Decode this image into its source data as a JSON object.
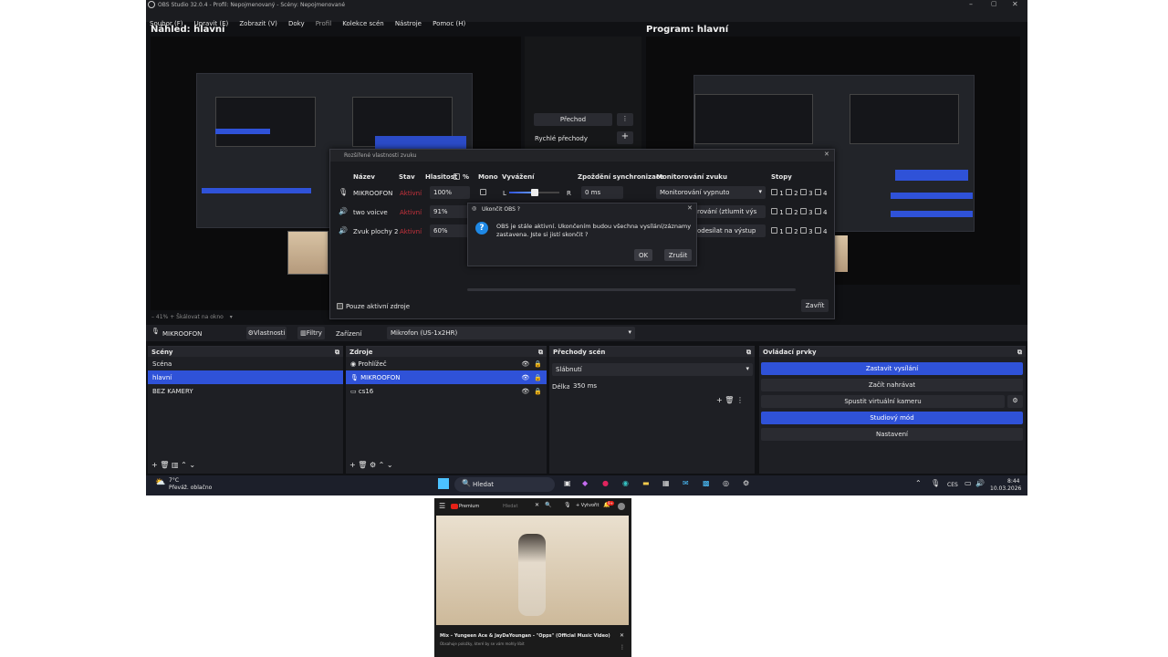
{
  "window": {
    "title": "OBS Studio 32.0.4 - Profil: Nepojmenovaný - Scény: Nepojmenované",
    "menu": [
      "Soubor (F)",
      "Upravit (E)",
      "Zobrazit (V)",
      "Doky",
      "Profil",
      "Kolekce scén",
      "Nástroje",
      "Pomoc (H)"
    ]
  },
  "preview": {
    "title": "Náhled: hlavní"
  },
  "program": {
    "title": "Program: hlavní"
  },
  "transition": {
    "button": "Přechod",
    "quick": "Rychlé přechody"
  },
  "advanced_audio": {
    "title": "Rozšířené vlastnosti zvuku",
    "headers": [
      "Název",
      "Stav",
      "Hlasitost",
      "%",
      "Mono",
      "Vyvážení",
      "Zpoždění synchronizace",
      "Monitorování zvuku",
      "Stopy"
    ],
    "rows": [
      {
        "name": "MIKROOFON",
        "status": "Aktivní",
        "volume": "100%",
        "sync": "0 ms",
        "monitor": "Monitorování vypnuto"
      },
      {
        "name": "two voicve",
        "status": "Aktivní",
        "volume": "91%",
        "monitor": "rování (ztlumit výs"
      },
      {
        "name": "Zvuk plochy 2",
        "status": "Aktivní",
        "volume": "60%",
        "monitor": "odesílat na výstup"
      }
    ],
    "balance_l": "L",
    "balance_r": "R",
    "tracks": [
      "1",
      "2",
      "3",
      "4"
    ],
    "only_active": "Pouze aktivní zdroje",
    "close": "Zavřít"
  },
  "quit_dialog": {
    "title": "Ukončit OBS ?",
    "message1": "OBS je stále aktivní. Ukončením budou všechna vysílání/záznamy",
    "message2": "zastavena. Jste si jistí skončit ?",
    "ok": "OK",
    "cancel": "Zrušit"
  },
  "source_toolbar": {
    "source": "MIKROOFON",
    "properties": "Vlastnosti",
    "filters": "Filtry",
    "device_label": "Zařízení",
    "device": "Mikrofon (US-1x2HR)"
  },
  "preview_toolbar": {
    "zoom": "41%",
    "scale": "Škálovat na okno"
  },
  "docks": {
    "scenes": {
      "title": "Scény",
      "items": [
        "Scéna",
        "hlavní",
        "BEZ KAMERY"
      ]
    },
    "sources": {
      "title": "Zdroje",
      "items": [
        "Prohlížeč",
        "MIKROOFON",
        "cs16"
      ]
    },
    "transitions": {
      "title": "Přechody scén",
      "type": "Slábnutí",
      "duration_label": "Délka",
      "duration": "350 ms"
    },
    "controls": {
      "title": "Ovládací prvky",
      "buttons": [
        "Zastavit vysílání",
        "Začít nahrávat",
        "Spustit virtuální kameru",
        "Studiový mód",
        "Nastavení"
      ]
    }
  },
  "taskbar": {
    "weather_temp": "7°C",
    "weather_desc": "Převáž. oblačno",
    "search": "Hledat",
    "lang": "CES",
    "time": "8:44",
    "date": "10.03.2026"
  },
  "video": {
    "brand": "Premium",
    "search_hint": "Hledat",
    "create": "Vytvořit",
    "badge": "9+",
    "title": "Mix – Yungeen Ace & JayDaYoungan - \"Opps\" (Official Music Video)",
    "subtitle": "Obsahuje položky, které by se vám mohly líbit"
  },
  "colors": {
    "accent": "#2f52d8",
    "background": "#101114",
    "status_red": "#c8323c"
  }
}
